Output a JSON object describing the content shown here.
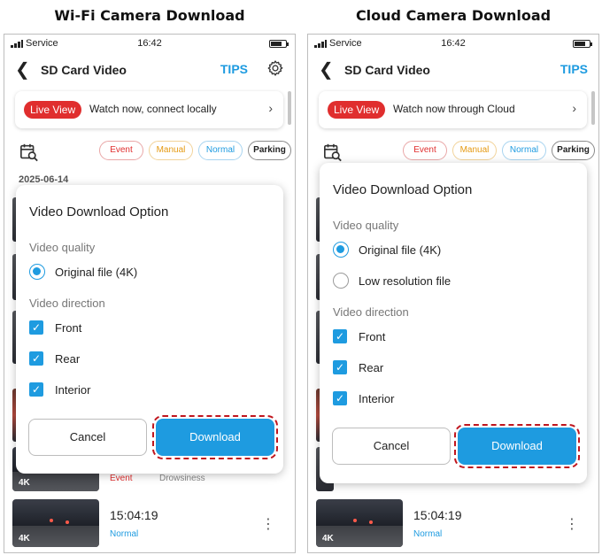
{
  "captions": {
    "left": "Wi-Fi Camera Download",
    "right": "Cloud Camera Download"
  },
  "colors": {
    "accent": "#1E9BE0",
    "live_red": "#E02E2E",
    "manual_orange": "#E59A12",
    "highlight_dashed": "#C0161E"
  },
  "wifi": {
    "status": {
      "carrier": "Service",
      "time": "16:42"
    },
    "nav": {
      "back_icon": "chevron-left-icon",
      "title": "SD Card Video",
      "tips": "TIPS",
      "settings_icon": "gear-icon"
    },
    "live": {
      "badge": "Live View",
      "text": "Watch now, connect locally",
      "chevron": "›"
    },
    "filters": [
      "Event",
      "Manual",
      "Normal",
      "Parking"
    ],
    "date": "2025-06-14",
    "rows": [
      {
        "badge": "4K",
        "event": "Event",
        "sub": "Drowsiness"
      },
      {
        "badge": "4K",
        "time": "15:04:19",
        "tag": "Normal"
      }
    ],
    "dialog": {
      "title": "Video Download Option",
      "quality_label": "Video quality",
      "quality_options": [
        {
          "label": "Original file (4K)",
          "selected": true
        }
      ],
      "direction_label": "Video direction",
      "directions": [
        {
          "label": "Front",
          "checked": true
        },
        {
          "label": "Rear",
          "checked": true
        },
        {
          "label": "Interior",
          "checked": true
        }
      ],
      "cancel": "Cancel",
      "download": "Download"
    }
  },
  "cloud": {
    "status": {
      "carrier": "Service",
      "time": "16:42"
    },
    "nav": {
      "back_icon": "chevron-left-icon",
      "title": "SD Card Video",
      "tips": "TIPS"
    },
    "live": {
      "badge": "Live View",
      "text": "Watch now through Cloud",
      "chevron": "›"
    },
    "filters": [
      "Event",
      "Manual",
      "Normal",
      "Parking"
    ],
    "rows": [
      {
        "badge": "4K",
        "time": "15:04:19",
        "tag": "Normal"
      }
    ],
    "dialog": {
      "title": "Video Download Option",
      "quality_label": "Video quality",
      "quality_options": [
        {
          "label": "Original file (4K)",
          "selected": true
        },
        {
          "label": "Low resolution file",
          "selected": false
        }
      ],
      "direction_label": "Video direction",
      "directions": [
        {
          "label": "Front",
          "checked": true
        },
        {
          "label": "Rear",
          "checked": true
        },
        {
          "label": "Interior",
          "checked": true
        }
      ],
      "cancel": "Cancel",
      "download": "Download"
    }
  }
}
